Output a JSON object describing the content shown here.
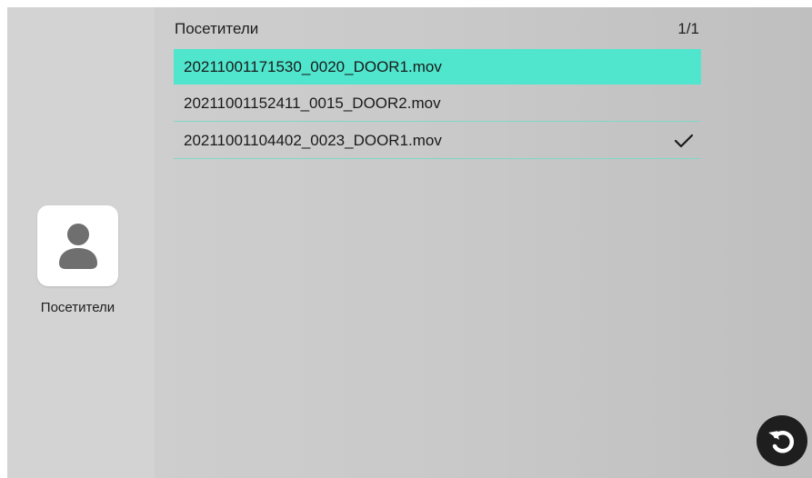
{
  "sidebar": {
    "items": [
      {
        "label": "Посетители",
        "icon": "person-icon"
      }
    ]
  },
  "list": {
    "title": "Посетители",
    "page": "1/1",
    "files": [
      {
        "name": "20211001171530_0020_DOOR1.mov",
        "selected": true,
        "checked": false
      },
      {
        "name": "20211001152411_0015_DOOR2.mov",
        "selected": false,
        "checked": false
      },
      {
        "name": "20211001104402_0023_DOOR1.mov",
        "selected": false,
        "checked": true
      }
    ]
  },
  "colors": {
    "selection": "#4fe6cd",
    "divider": "#7fd9c6",
    "back_button": "#1e1e1e"
  },
  "icons": {
    "back": "undo-arrow-icon",
    "check": "check-icon"
  }
}
